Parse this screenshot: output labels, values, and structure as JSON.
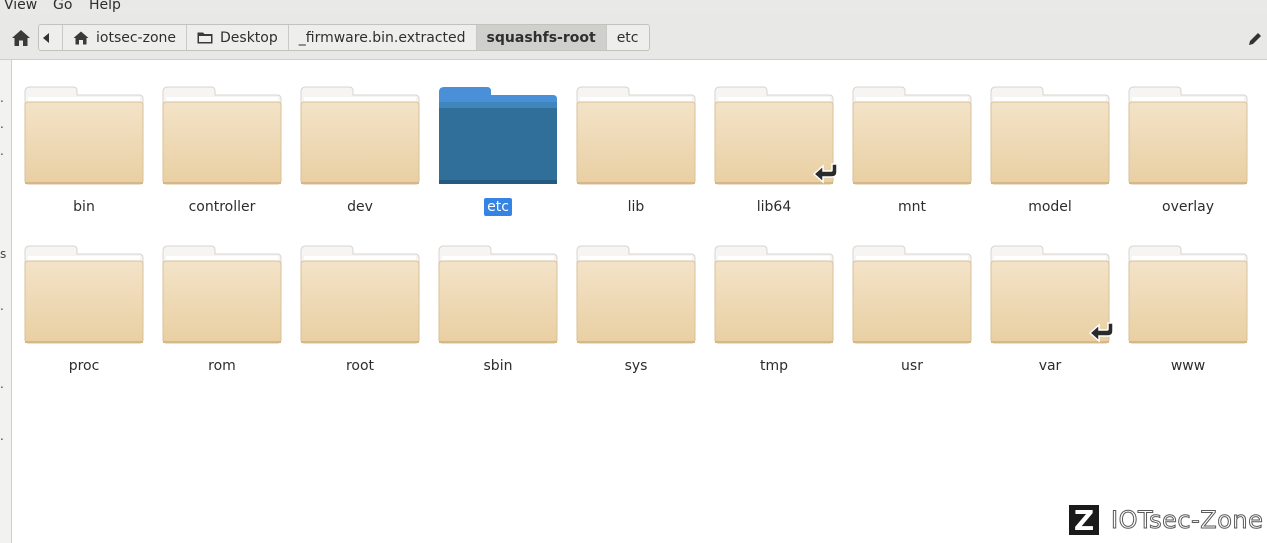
{
  "menu": {
    "items": [
      "View",
      "Go",
      "Help"
    ]
  },
  "pathbar": {
    "crumbs": [
      "iotsec-zone",
      "Desktop",
      "_firmware.bin.extracted",
      "squashfs-root",
      "etc"
    ],
    "active_crumb": "squashfs-root"
  },
  "sidebar": {
    "clipped_chars": [
      ".",
      ".",
      ".",
      "s",
      ".",
      ".",
      "."
    ]
  },
  "folders": [
    {
      "name": "bin",
      "selected": false,
      "symlink": false
    },
    {
      "name": "controller",
      "selected": false,
      "symlink": false
    },
    {
      "name": "dev",
      "selected": false,
      "symlink": false
    },
    {
      "name": "etc",
      "selected": true,
      "symlink": false
    },
    {
      "name": "lib",
      "selected": false,
      "symlink": false
    },
    {
      "name": "lib64",
      "selected": false,
      "symlink": true
    },
    {
      "name": "mnt",
      "selected": false,
      "symlink": false
    },
    {
      "name": "model",
      "selected": false,
      "symlink": false
    },
    {
      "name": "overlay",
      "selected": false,
      "symlink": false
    },
    {
      "name": "proc",
      "selected": false,
      "symlink": false
    },
    {
      "name": "rom",
      "selected": false,
      "symlink": false
    },
    {
      "name": "root",
      "selected": false,
      "symlink": false
    },
    {
      "name": "sbin",
      "selected": false,
      "symlink": false
    },
    {
      "name": "sys",
      "selected": false,
      "symlink": false
    },
    {
      "name": "tmp",
      "selected": false,
      "symlink": false
    },
    {
      "name": "usr",
      "selected": false,
      "symlink": false
    },
    {
      "name": "var",
      "selected": false,
      "symlink": true
    },
    {
      "name": "www",
      "selected": false,
      "symlink": false
    }
  ],
  "icons": {
    "home": "home-icon",
    "back": "chevron-left-icon",
    "edit": "pencil-icon",
    "folder": "folder-icon",
    "symlink": "symlink-arrow-icon"
  },
  "colors": {
    "selection": "#3584e4",
    "folder_selected": "#2f6f9a",
    "folder_normal": "#efd9b4"
  },
  "watermark": {
    "logo": "Z",
    "text": "IOTsec-Zone"
  }
}
